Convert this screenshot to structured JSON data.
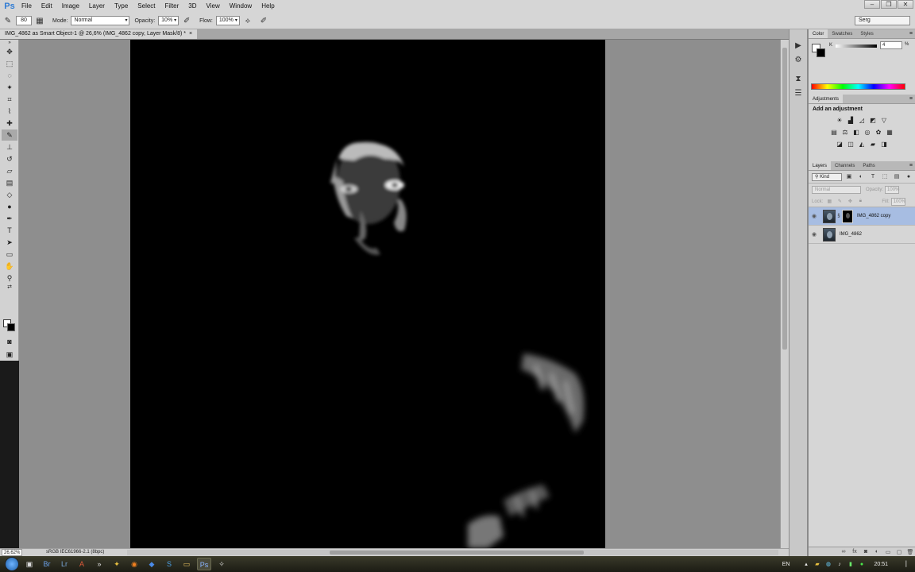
{
  "app": {
    "logo": "Ps"
  },
  "menu": [
    "File",
    "Edit",
    "Image",
    "Layer",
    "Type",
    "Select",
    "Filter",
    "3D",
    "View",
    "Window",
    "Help"
  ],
  "options": {
    "brush_size": "80",
    "mode_label": "Mode:",
    "mode_value": "Normal",
    "opacity_label": "Opacity:",
    "opacity_value": "10%",
    "flow_label": "Flow:",
    "flow_value": "100%",
    "workspace": "Serg"
  },
  "document": {
    "tab_title": "IMG_4862 as Smart Object-1 @ 26,6% (IMG_4862 copy, Layer Mask/8) *",
    "zoom": "26,62%",
    "info": "sRGB IEC61966-2.1 (8bpc)"
  },
  "color_panel": {
    "tabs": [
      "Color",
      "Swatches",
      "Styles"
    ],
    "channel_label": "K",
    "channel_value": "4",
    "unit": "%"
  },
  "adjustments_panel": {
    "tab": "Adjustments",
    "title": "Add an adjustment"
  },
  "layers_panel": {
    "tabs": [
      "Layers",
      "Channels",
      "Paths"
    ],
    "kind": "Kind",
    "blend_mode": "Normal",
    "opacity_label": "Opacity:",
    "opacity_value": "100%",
    "lock_label": "Lock:",
    "fill_label": "Fill:",
    "fill_value": "100%",
    "layers": [
      {
        "name": "IMG_4862 copy",
        "selected": true,
        "has_mask": true
      },
      {
        "name": "IMG_4862",
        "selected": false,
        "has_mask": false
      }
    ]
  },
  "taskbar": {
    "language": "EN",
    "clock": "20:51"
  }
}
